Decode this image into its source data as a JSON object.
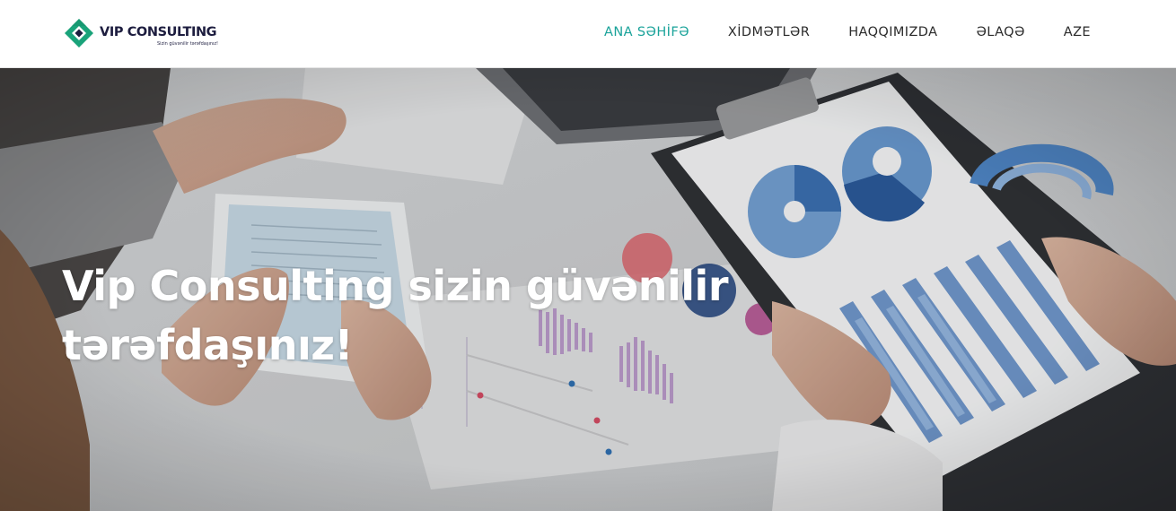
{
  "header": {
    "logo": {
      "name": "VIP CONSULTING",
      "tagline": "Sizin güvənilir tərəfdaşınız!",
      "colors": {
        "mark_green": "#1aa37a",
        "mark_navy": "#1d1d3f"
      }
    },
    "nav": [
      {
        "label": "ANA SƏHİFƏ",
        "active": true
      },
      {
        "label": "XİDMƏTLƏR",
        "active": false
      },
      {
        "label": "HAQQIMIZDA",
        "active": false
      },
      {
        "label": "ƏLAQƏ",
        "active": false
      },
      {
        "label": "AZE",
        "active": false
      }
    ],
    "accent_color": "#1aa39a"
  },
  "hero": {
    "title": "Vip Consulting sizin güvənilir tərəfdaşınız!",
    "background": "photo: hands working with tablet, laptop and clipboard of charts on a white desk"
  }
}
